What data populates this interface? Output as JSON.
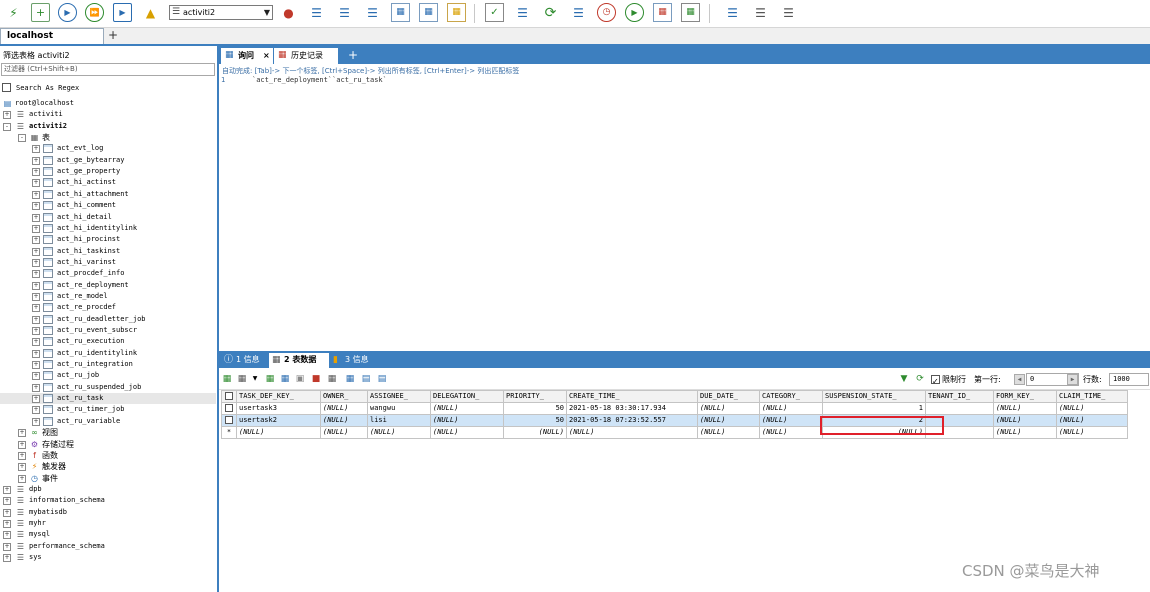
{
  "toolbar": {
    "selected_database": "activiti2",
    "icons": [
      "new-connection-icon",
      "new-query-icon",
      "run-icon",
      "run-all-icon",
      "run-current-icon",
      "user-manager-icon",
      "schema-designer-icon",
      "create-database-icon",
      "create-table-icon",
      "table-data-icon",
      "import-icon",
      "export-icon",
      "structure-icon",
      "copy-database-icon",
      "sync-data-icon",
      "refresh-icon",
      "backup-icon",
      "scheduler-icon",
      "history-icon",
      "window-icon",
      "compare-icon",
      "db-sync-icon",
      "db-import-icon",
      "db-export-icon"
    ]
  },
  "connection_tab": {
    "label": "localhost",
    "add": "+"
  },
  "left_panel": {
    "title": "筛选表格 activiti2",
    "filter_placeholder": "过滤器 (Ctrl+Shift+B)",
    "regex_label": "Search As Regex",
    "tree": [
      {
        "label": "root@localhost",
        "level": 0,
        "type": "server",
        "expander": ""
      },
      {
        "label": "activiti",
        "level": 0,
        "type": "db",
        "expander": "+"
      },
      {
        "label": "activiti2",
        "level": 0,
        "type": "db",
        "expander": "-",
        "bold": true
      },
      {
        "label": "表",
        "level": 1,
        "type": "folder",
        "expander": "-"
      },
      {
        "label": "act_evt_log",
        "level": 2,
        "type": "table",
        "expander": "+"
      },
      {
        "label": "act_ge_bytearray",
        "level": 2,
        "type": "table",
        "expander": "+"
      },
      {
        "label": "act_ge_property",
        "level": 2,
        "type": "table",
        "expander": "+"
      },
      {
        "label": "act_hi_actinst",
        "level": 2,
        "type": "table",
        "expander": "+"
      },
      {
        "label": "act_hi_attachment",
        "level": 2,
        "type": "table",
        "expander": "+"
      },
      {
        "label": "act_hi_comment",
        "level": 2,
        "type": "table",
        "expander": "+"
      },
      {
        "label": "act_hi_detail",
        "level": 2,
        "type": "table",
        "expander": "+"
      },
      {
        "label": "act_hi_identitylink",
        "level": 2,
        "type": "table",
        "expander": "+"
      },
      {
        "label": "act_hi_procinst",
        "level": 2,
        "type": "table",
        "expander": "+"
      },
      {
        "label": "act_hi_taskinst",
        "level": 2,
        "type": "table",
        "expander": "+"
      },
      {
        "label": "act_hi_varinst",
        "level": 2,
        "type": "table",
        "expander": "+"
      },
      {
        "label": "act_procdef_info",
        "level": 2,
        "type": "table",
        "expander": "+"
      },
      {
        "label": "act_re_deployment",
        "level": 2,
        "type": "table",
        "expander": "+"
      },
      {
        "label": "act_re_model",
        "level": 2,
        "type": "table",
        "expander": "+"
      },
      {
        "label": "act_re_procdef",
        "level": 2,
        "type": "table",
        "expander": "+"
      },
      {
        "label": "act_ru_deadletter_job",
        "level": 2,
        "type": "table",
        "expander": "+"
      },
      {
        "label": "act_ru_event_subscr",
        "level": 2,
        "type": "table",
        "expander": "+"
      },
      {
        "label": "act_ru_execution",
        "level": 2,
        "type": "table",
        "expander": "+"
      },
      {
        "label": "act_ru_identitylink",
        "level": 2,
        "type": "table",
        "expander": "+"
      },
      {
        "label": "act_ru_integration",
        "level": 2,
        "type": "table",
        "expander": "+"
      },
      {
        "label": "act_ru_job",
        "level": 2,
        "type": "table",
        "expander": "+"
      },
      {
        "label": "act_ru_suspended_job",
        "level": 2,
        "type": "table",
        "expander": "+"
      },
      {
        "label": "act_ru_task",
        "level": 2,
        "type": "table",
        "expander": "+",
        "selected": true
      },
      {
        "label": "act_ru_timer_job",
        "level": 2,
        "type": "table",
        "expander": "+"
      },
      {
        "label": "act_ru_variable",
        "level": 2,
        "type": "table",
        "expander": "+"
      },
      {
        "label": "视图",
        "level": 1,
        "type": "view",
        "expander": "+"
      },
      {
        "label": "存储过程",
        "level": 1,
        "type": "proc",
        "expander": "+"
      },
      {
        "label": "函数",
        "level": 1,
        "type": "func",
        "expander": "+"
      },
      {
        "label": "触发器",
        "level": 1,
        "type": "trigger",
        "expander": "+"
      },
      {
        "label": "事件",
        "level": 1,
        "type": "event",
        "expander": "+"
      },
      {
        "label": "dpb",
        "level": 0,
        "type": "db",
        "expander": "+"
      },
      {
        "label": "information_schema",
        "level": 0,
        "type": "db",
        "expander": "+"
      },
      {
        "label": "mybatisdb",
        "level": 0,
        "type": "db",
        "expander": "+"
      },
      {
        "label": "myhr",
        "level": 0,
        "type": "db",
        "expander": "+"
      },
      {
        "label": "mysql",
        "level": 0,
        "type": "db",
        "expander": "+"
      },
      {
        "label": "performance_schema",
        "level": 0,
        "type": "db",
        "expander": "+"
      },
      {
        "label": "sys",
        "level": 0,
        "type": "db",
        "expander": "+"
      }
    ]
  },
  "query_tabs": [
    {
      "label": "询问",
      "close": "×"
    },
    {
      "label": "历史记录"
    }
  ],
  "query_tab_add": "+",
  "editor": {
    "hint": "自动完成: [Tab]-> 下一个标签, [Ctrl+Space]-> 列出所有标签, [Ctrl+Enter]-> 列出匹配标签",
    "line_number": "1",
    "code": "`act_re_deployment``act_ru_task`"
  },
  "result_tabs": [
    {
      "label": "1 信息"
    },
    {
      "label": "2 表数据"
    },
    {
      "label": "3 信息"
    }
  ],
  "result_toolbar": {
    "limit_label": "限制行",
    "first_row_label": "第一行:",
    "first_row_value": "0",
    "rows_label": "行数:",
    "rows_value": "1000"
  },
  "grid": {
    "columns": [
      "TASK_DEF_KEY_",
      "OWNER_",
      "ASSIGNEE_",
      "DELEGATION_",
      "PRIORITY_",
      "CREATE_TIME_",
      "DUE_DATE_",
      "CATEGORY_",
      "SUSPENSION_STATE_",
      "TENANT_ID_",
      "FORM_KEY_",
      "CLAIM_TIME_"
    ],
    "rows": [
      [
        "usertask3",
        "(NULL)",
        "wangwu",
        "(NULL)",
        "50",
        "2021-05-18 03:30:17.934",
        "(NULL)",
        "(NULL)",
        "1",
        "",
        "(NULL)",
        "(NULL)"
      ],
      [
        "usertask2",
        "(NULL)",
        "lisi",
        "(NULL)",
        "50",
        "2021-05-18 07:23:52.557",
        "(NULL)",
        "(NULL)",
        "2",
        "",
        "(NULL)",
        "(NULL)"
      ],
      [
        "(NULL)",
        "(NULL)",
        "(NULL)",
        "(NULL)",
        "(NULL)",
        "(NULL)",
        "(NULL)",
        "(NULL)",
        "(NULL)",
        "",
        "(NULL)",
        "(NULL)"
      ]
    ],
    "new_row_marker": "*"
  },
  "watermark": "CSDN @菜鸟是大神"
}
